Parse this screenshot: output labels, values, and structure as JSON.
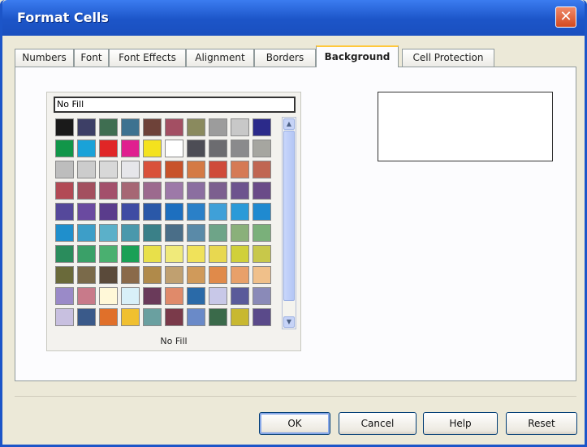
{
  "window": {
    "title": "Format Cells",
    "close_glyph": "✕"
  },
  "tabs": [
    {
      "label": "Numbers"
    },
    {
      "label": "Font"
    },
    {
      "label": "Font Effects"
    },
    {
      "label": "Alignment"
    },
    {
      "label": "Borders"
    },
    {
      "label": "Background",
      "active": true
    },
    {
      "label": "Cell Protection"
    }
  ],
  "background": {
    "selected_color_name": "No Fill",
    "palette_caption": "No Fill",
    "palette": [
      [
        "#1a1a1a",
        "#3d3f66",
        "#3f6e51",
        "#3d7290",
        "#6e4239",
        "#a34f63",
        "#8a8a5e",
        "#9c9c9c",
        "#c8c8c8",
        "#2b2a8a"
      ],
      [
        "#119649",
        "#1aa2d8",
        "#e02626",
        "#e01f8f",
        "#f4e21e",
        "#ffffff",
        "#4d4d55",
        "#6c6c70",
        "#8a8a8c",
        "#a6a6a0"
      ],
      [
        "#bdbdbd",
        "#cccccc",
        "#d8d8d8",
        "#e6e6ea",
        "#d9513a",
        "#c8522a",
        "#d47a45",
        "#cf4a3a",
        "#d57a55",
        "#c06652"
      ],
      [
        "#b24a55",
        "#a3505f",
        "#a3506b",
        "#a66774",
        "#9c6a8e",
        "#9d79a8",
        "#8b6ea0",
        "#7c5f8f",
        "#6d548e",
        "#6a4b88"
      ],
      [
        "#55489b",
        "#6a4aa0",
        "#5a3c8c",
        "#3f4ca3",
        "#2a58a8",
        "#1d6fbf",
        "#2a80c8",
        "#3fa0d8",
        "#2a9ad8",
        "#1f8ad0"
      ],
      [
        "#1f8fcc",
        "#3d9ec8",
        "#5bb0c9",
        "#4a98ac",
        "#3a8088",
        "#4a6e88",
        "#5a8aa8",
        "#6ea488",
        "#8ab07a",
        "#7ab07a"
      ],
      [
        "#2a8c5c",
        "#3aa068",
        "#4ab070",
        "#1aa056",
        "#e8e04a",
        "#f0ea7a",
        "#f0e25a",
        "#e8d850",
        "#d0d03a",
        "#c8c84a"
      ],
      [
        "#6a6a3a",
        "#7a6a4a",
        "#5a4a3a",
        "#8a6a4a",
        "#b08a4a",
        "#c0a070",
        "#d09a5a",
        "#e08a4a",
        "#e8a06a",
        "#f0c08a"
      ],
      [
        "#9a8ac8",
        "#c87a8a",
        "#fff8d8",
        "#d8f0f8",
        "#6a3a5a",
        "#e08a6a",
        "#2a6aa8",
        "#c8c8e8",
        "#5a5a9a",
        "#8a8ab8"
      ],
      [
        "#c8c0e0",
        "#3a5a8a",
        "#e0702a",
        "#f0c030",
        "#6aa0a0",
        "#7a3a4a",
        "#6a8ac8",
        "#3a6a4a",
        "#c8b830",
        "#5a4a8a"
      ]
    ]
  },
  "buttons": {
    "ok": "OK",
    "cancel": "Cancel",
    "help": "Help",
    "reset": "Reset"
  }
}
